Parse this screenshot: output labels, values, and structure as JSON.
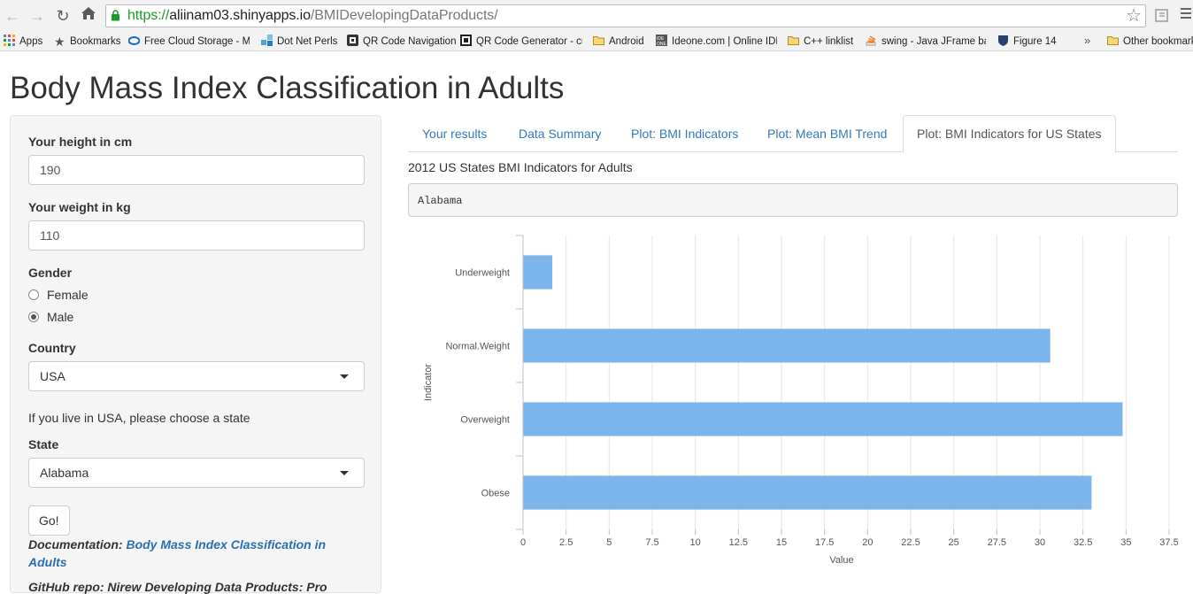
{
  "browser": {
    "url_scheme": "https://",
    "url_host": "aliinam03.shinyapps.io",
    "url_path": "/BMIDevelopingDataProducts/"
  },
  "bookmarks": [
    {
      "label": "Apps",
      "icon": "apps-grid-icon"
    },
    {
      "label": "Bookmarks",
      "icon": "star-icon"
    },
    {
      "label": "Free Cloud Storage - Me",
      "icon": "cloud-icon"
    },
    {
      "label": "Dot Net Perls",
      "icon": "dotnetperls-icon"
    },
    {
      "label": "QR Code Navigation",
      "icon": "qr-icon"
    },
    {
      "label": "QR Code Generator - cr",
      "icon": "qr-generator-icon"
    },
    {
      "label": "Android",
      "icon": "folder-icon"
    },
    {
      "label": "Ideone.com | Online IDE",
      "icon": "ideone-icon"
    },
    {
      "label": "C++ linklist",
      "icon": "folder-icon"
    },
    {
      "label": "swing - Java JFrame bac",
      "icon": "stackoverflow-icon"
    },
    {
      "label": "Figure 14",
      "icon": "shield-icon"
    },
    {
      "label": "Other bookmarks",
      "icon": "folder-icon"
    }
  ],
  "bookmarks_more": "»",
  "page": {
    "title": "Body Mass Index Classification in Adults"
  },
  "sidebar": {
    "height_label": "Your height in cm",
    "height_value": "190",
    "weight_label": "Your weight in kg",
    "weight_value": "110",
    "gender_label": "Gender",
    "gender_options": [
      "Female",
      "Male"
    ],
    "gender_selected": "Male",
    "country_label": "Country",
    "country_value": "USA",
    "state_hint": "If you live in USA, please choose a state",
    "state_label": "State",
    "state_value": "Alabama",
    "go_label": "Go!",
    "doc_prefix": "Documentation:",
    "doc_link": "Body Mass Index Classification in Adults",
    "gh_text": "GitHub repo: Nirew Developing Data Products: Pro"
  },
  "tabs": [
    {
      "label": "Your results",
      "active": false
    },
    {
      "label": "Data Summary",
      "active": false
    },
    {
      "label": "Plot: BMI Indicators",
      "active": false
    },
    {
      "label": "Plot: Mean BMI Trend",
      "active": false
    },
    {
      "label": "Plot: BMI Indicators for US States",
      "active": true
    }
  ],
  "main": {
    "caption": "2012 US States BMI Indicators for Adults",
    "state_output": "Alabama"
  },
  "chart_data": {
    "type": "bar",
    "orientation": "horizontal",
    "categories": [
      "Underweight",
      "Normal.Weight",
      "Overweight",
      "Obese"
    ],
    "values": [
      1.7,
      30.6,
      34.8,
      33.0
    ],
    "xlabel": "Value",
    "ylabel": "Indicator",
    "xlim": [
      0,
      37.5
    ],
    "xticks": [
      "0",
      "2.5",
      "5",
      "7.5",
      "10",
      "12.5",
      "15",
      "17.5",
      "20",
      "22.5",
      "25",
      "27.5",
      "30",
      "32.5",
      "35",
      "37.5"
    ],
    "bar_color": "#7cb5ec",
    "grid": true
  }
}
